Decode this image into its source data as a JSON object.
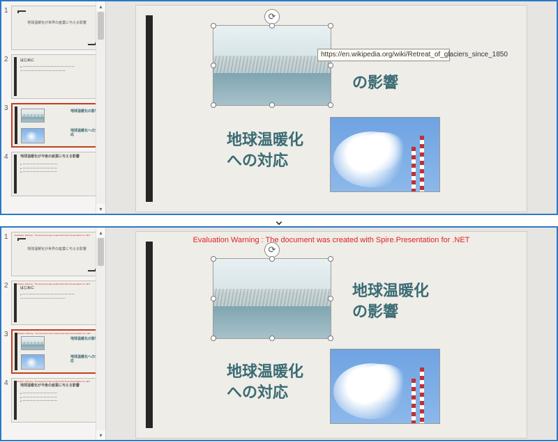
{
  "tooltip_url": "https://en.wikipedia.org/wiki/Retreat_of_glaciers_since_1850",
  "eval_warning": "Evaluation Warning : The document was created with  Spire.Presentation for .NET",
  "slide": {
    "caption1_partial": "の影響",
    "caption1_full_line1": "地球温暖化",
    "caption1_full_line2": "の影響",
    "caption2_line1": "地球温暖化",
    "caption2_line2": "への対応"
  },
  "thumbnails": [
    {
      "num": "1",
      "title": "地球温暖化が世界の産業に与える影響",
      "sub": ""
    },
    {
      "num": "2",
      "title": "はじめに",
      "sub": ""
    },
    {
      "num": "3",
      "title_a": "地球温暖化の影響",
      "title_b": "地球温暖化への対応"
    },
    {
      "num": "4",
      "title": "地球温暖化が今後の産業に与える影響",
      "sub": ""
    }
  ],
  "icons": {
    "rotate": "⟳",
    "arrow_down": "⌄",
    "scroll_up": "▴",
    "scroll_down": "▾"
  }
}
